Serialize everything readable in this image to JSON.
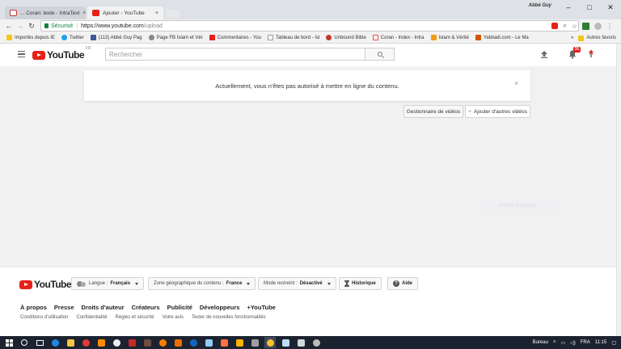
{
  "browser": {
    "tabs": [
      {
        "label": "... Coran: texte - IntraText"
      },
      {
        "label": "Ajouter - YouTube"
      }
    ],
    "profile_name": "Abbé Guy",
    "omnibox": {
      "secure_label": "Sécurisé",
      "url_host": "https://www.youtube.com",
      "url_path": "/upload"
    },
    "bookmarks": [
      {
        "label": "Importés depuis IE",
        "color": "#f5c518"
      },
      {
        "label": "Twitter",
        "color": "#1da1f2"
      },
      {
        "label": "(113) Abbé Guy Pag",
        "color": "#3b5998"
      },
      {
        "label": "Page FB Islam et Vér",
        "color": "#888888"
      },
      {
        "label": "Commentaires - You",
        "color": "#e62117"
      },
      {
        "label": "Tableau de bord - Isl",
        "color": "#aaaaaa"
      },
      {
        "label": "Unbound Bible",
        "color": "#c0392b"
      },
      {
        "label": "Coran - Index - Intra",
        "color": "#e74c3c"
      },
      {
        "label": "Islam & Vérité",
        "color": "#f39c12"
      },
      {
        "label": "Yabiladi.com - Le Ma",
        "color": "#d35400"
      }
    ],
    "bookmarks_overflow": "»",
    "other_bookmarks": "Autres favoris"
  },
  "youtube": {
    "logo_text": "YouTube",
    "logo_region": "FR",
    "search_placeholder": "Rechercher",
    "notification_count": "31",
    "alert_message": "Actuellement, vous n'êtes pas autorisé à mettre en ligne du contenu.",
    "alert_close": "×",
    "video_manager_label": "Gestionnaire de vidéos",
    "add_more_label": "Ajouter d'autres vidéos",
    "add_more_prefix": "+",
    "hidden_button_label": "Publier Résultats"
  },
  "footer": {
    "logo_text": "YouTube",
    "language_label": "Langue :",
    "language_value": "Français",
    "region_label": "Zone géographique du contenu :",
    "region_value": "France",
    "restricted_label": "Mode restreint :",
    "restricted_value": "Désactivé",
    "history_label": "Historique",
    "help_label": "Aide",
    "links_primary": [
      "À propos",
      "Presse",
      "Droits d'auteur",
      "Créateurs",
      "Publicité",
      "Développeurs",
      "+YouTube"
    ],
    "links_secondary": [
      "Conditions d'utilisation",
      "Confidentialité",
      "Règles et sécurité",
      "Votre avis",
      "Tester de nouvelles fonctionnalités"
    ]
  },
  "taskbar": {
    "desktop_label": "Bureau",
    "lang": "FRA",
    "time": "11:15"
  },
  "colors": {
    "yt_red": "#e62117",
    "page_bg": "#f1f1f1",
    "secure_green": "#0b8043"
  }
}
